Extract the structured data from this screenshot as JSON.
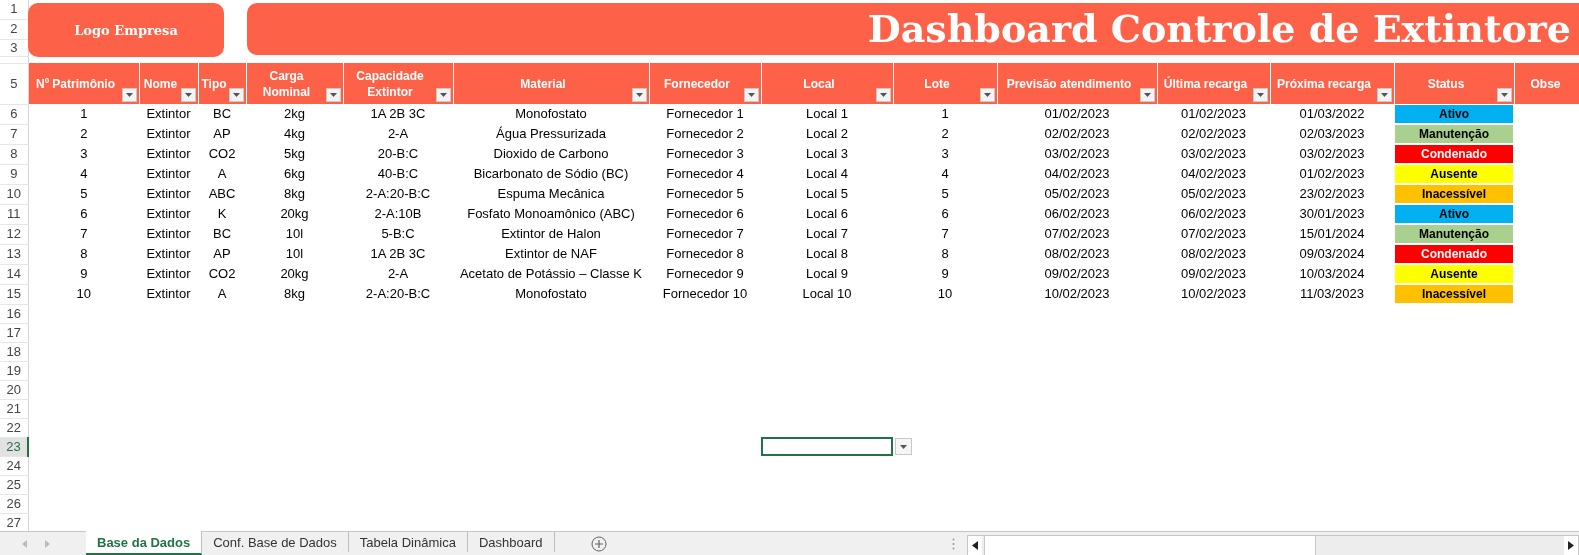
{
  "logo": {
    "text": "Logo Empresa"
  },
  "title": {
    "text": "Dashboard Controle de Extintore"
  },
  "table": {
    "columns": [
      {
        "label": "Nº Patrimônio",
        "filter": true
      },
      {
        "label": "Nome",
        "filter": true
      },
      {
        "label": "Tipo",
        "filter": true
      },
      {
        "label": "Carga Nominal",
        "filter": true
      },
      {
        "label": "Capacidade Extintor",
        "filter": true
      },
      {
        "label": "Material",
        "filter": true
      },
      {
        "label": "Fornecedor",
        "filter": true
      },
      {
        "label": "Local",
        "filter": true
      },
      {
        "label": "Lote",
        "filter": true
      },
      {
        "label": "Previsão atendimento",
        "filter": true
      },
      {
        "label": "Última recarga",
        "filter": true
      },
      {
        "label": "Próxima recarga",
        "filter": true
      },
      {
        "label": "Status",
        "filter": true
      },
      {
        "label": "Obse",
        "filter": false
      }
    ],
    "rows": [
      {
        "cells": [
          "1",
          "Extintor",
          "BC",
          "2kg",
          "1A 2B 3C",
          "Monofostato",
          "Fornecedor 1",
          "Local 1",
          "1",
          "01/02/2023",
          "01/02/2023",
          "01/03/2022"
        ],
        "status": {
          "label": "Ativo",
          "color": "#00b0f0"
        }
      },
      {
        "cells": [
          "2",
          "Extintor",
          "AP",
          "4kg",
          "2-A",
          "Água Pressurizada",
          "Fornecedor 2",
          "Local 2",
          "2",
          "02/02/2023",
          "02/02/2023",
          "02/03/2023"
        ],
        "status": {
          "label": "Manutenção",
          "color": "#a9d08e"
        }
      },
      {
        "cells": [
          "3",
          "Extintor",
          "CO2",
          "5kg",
          "20-B:C",
          "Dioxido de Carbono",
          "Fornecedor 3",
          "Local 3",
          "3",
          "03/02/2023",
          "03/02/2023",
          "03/02/2023"
        ],
        "status": {
          "label": "Condenado",
          "color": "#ff0000"
        }
      },
      {
        "cells": [
          "4",
          "Extintor",
          "A",
          "6kg",
          "40-B:C",
          "Bicarbonato de Sódio (BC)",
          "Fornecedor 4",
          "Local 4",
          "4",
          "04/02/2023",
          "04/02/2023",
          "01/02/2023"
        ],
        "status": {
          "label": "Ausente",
          "color": "#ffff00"
        }
      },
      {
        "cells": [
          "5",
          "Extintor",
          "ABC",
          "8kg",
          "2-A:20-B:C",
          "Espuma Mecânica",
          "Fornecedor 5",
          "Local 5",
          "5",
          "05/02/2023",
          "05/02/2023",
          "23/02/2023"
        ],
        "status": {
          "label": "Inacessível",
          "color": "#ffc000"
        }
      },
      {
        "cells": [
          "6",
          "Extintor",
          "K",
          "20kg",
          "2-A:10B",
          "Fosfato Monoamônico (ABC)",
          "Fornecedor 6",
          "Local 6",
          "6",
          "06/02/2023",
          "06/02/2023",
          "30/01/2023"
        ],
        "status": {
          "label": "Ativo",
          "color": "#00b0f0"
        }
      },
      {
        "cells": [
          "7",
          "Extintor",
          "BC",
          "10l",
          "5-B:C",
          "Extintor de Halon",
          "Fornecedor 7",
          "Local 7",
          "7",
          "07/02/2023",
          "07/02/2023",
          "15/01/2024"
        ],
        "status": {
          "label": "Manutenção",
          "color": "#a9d08e"
        }
      },
      {
        "cells": [
          "8",
          "Extintor",
          "AP",
          "10l",
          "1A 2B 3C",
          "Extintor de NAF",
          "Fornecedor 8",
          "Local 8",
          "8",
          "08/02/2023",
          "08/02/2023",
          "09/03/2024"
        ],
        "status": {
          "label": "Condenado",
          "color": "#ff0000"
        }
      },
      {
        "cells": [
          "9",
          "Extintor",
          "CO2",
          "20kg",
          "2-A",
          "Acetato de Potássio – Classe K",
          "Fornecedor 9",
          "Local 9",
          "9",
          "09/02/2023",
          "09/02/2023",
          "10/03/2024"
        ],
        "status": {
          "label": "Ausente",
          "color": "#ffff00"
        }
      },
      {
        "cells": [
          "10",
          "Extintor",
          "A",
          "8kg",
          "2-A:20-B:C",
          "Monofostato",
          "Fornecedor 10",
          "Local 10",
          "10",
          "10/02/2023",
          "10/02/2023",
          "11/03/2023"
        ],
        "status": {
          "label": "Inacessível",
          "color": "#ffc000"
        }
      }
    ]
  },
  "row_headers": [
    {
      "label": "1",
      "selected": false
    },
    {
      "label": "2",
      "selected": false
    },
    {
      "label": "3",
      "selected": false
    },
    {
      "label": "5",
      "selected": false
    },
    {
      "label": "6",
      "selected": false
    },
    {
      "label": "7",
      "selected": false
    },
    {
      "label": "8",
      "selected": false
    },
    {
      "label": "9",
      "selected": false
    },
    {
      "label": "10",
      "selected": false
    },
    {
      "label": "11",
      "selected": false
    },
    {
      "label": "12",
      "selected": false
    },
    {
      "label": "13",
      "selected": false
    },
    {
      "label": "14",
      "selected": false
    },
    {
      "label": "15",
      "selected": false
    },
    {
      "label": "16",
      "selected": false
    },
    {
      "label": "17",
      "selected": false
    },
    {
      "label": "18",
      "selected": false
    },
    {
      "label": "19",
      "selected": false
    },
    {
      "label": "20",
      "selected": false
    },
    {
      "label": "21",
      "selected": false
    },
    {
      "label": "22",
      "selected": false
    },
    {
      "label": "23",
      "selected": true
    },
    {
      "label": "24",
      "selected": false
    },
    {
      "label": "25",
      "selected": false
    },
    {
      "label": "26",
      "selected": false
    },
    {
      "label": "27",
      "selected": false
    }
  ],
  "sheet_tabs": [
    {
      "label": "Base da Dados",
      "selected": true
    },
    {
      "label": "Conf. Base de Dados",
      "selected": false
    },
    {
      "label": "Tabela Dinâmica",
      "selected": false
    },
    {
      "label": "Dashboard",
      "selected": false
    }
  ]
}
